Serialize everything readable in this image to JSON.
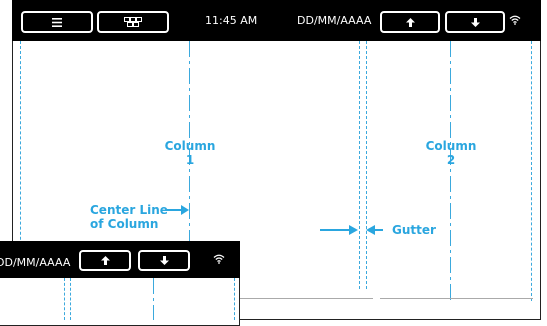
{
  "top_bar": {
    "time": "11:45 AM",
    "date": "DD/MM/AAAA",
    "icons": [
      "menu-icon",
      "grid-icon",
      "arrow-up-icon",
      "arrow-down-icon",
      "wifi-icon"
    ]
  },
  "annotations": {
    "column1_line1": "Column",
    "column1_line2": "1",
    "column2_line1": "Column",
    "column2_line2": "2",
    "center_line_1": "Center Line",
    "center_line_2": "of Column",
    "gutter": "Gutter"
  },
  "small_top_bar": {
    "date": "DD/MM/AAAA"
  },
  "colors": {
    "accent": "#2aa6df",
    "bar": "#000000"
  }
}
